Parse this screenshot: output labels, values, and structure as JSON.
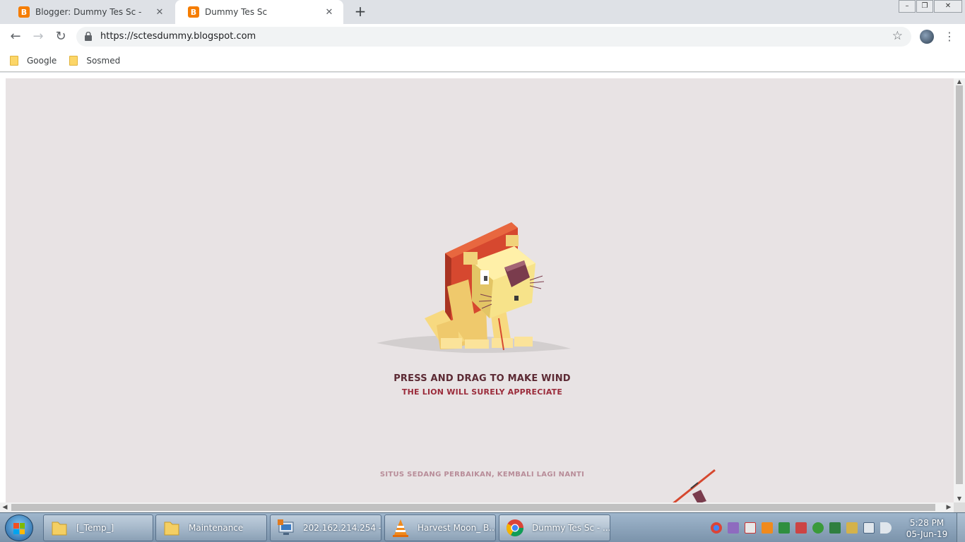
{
  "browser": {
    "tabs": [
      {
        "title": "Blogger: Dummy Tes Sc -",
        "favicon": "blogger-icon",
        "active": false
      },
      {
        "title": "Dummy Tes Sc",
        "favicon": "blogger-icon",
        "active": true
      }
    ],
    "new_tab_label": "+",
    "url": "https://sctesdummy.blogspot.com",
    "bookmarks": [
      {
        "label": "Google",
        "icon": "folder-icon"
      },
      {
        "label": "Sosmed",
        "icon": "folder-icon"
      }
    ]
  },
  "page": {
    "headline": "PRESS AND DRAG TO MAKE WIND",
    "subline": "THE LION WILL SURELY APPRECIATE",
    "notice": "SITUS SEDANG PERBAIKAN, KEMBALI LAGI NANTI",
    "colors": {
      "background": "#e8e3e4",
      "headline": "#5c2a34",
      "subline": "#9b2c3b",
      "notice": "#b88d99",
      "mane": "#d6482f",
      "lion_body": "#f7d980"
    }
  },
  "taskbar": {
    "items": [
      {
        "label": "[_Temp_]",
        "icon": "folder-icon"
      },
      {
        "label": "Maintenance",
        "icon": "folder-icon"
      },
      {
        "label": "202.162.214.254 - ...",
        "icon": "remote-desktop-icon"
      },
      {
        "label": "Harvest Moon_ B...",
        "icon": "vlc-icon"
      },
      {
        "label": "Dummy Tes Sc - ...",
        "icon": "chrome-icon"
      }
    ],
    "clock": {
      "time": "5:28 PM",
      "date": "05-Jun-19"
    }
  }
}
